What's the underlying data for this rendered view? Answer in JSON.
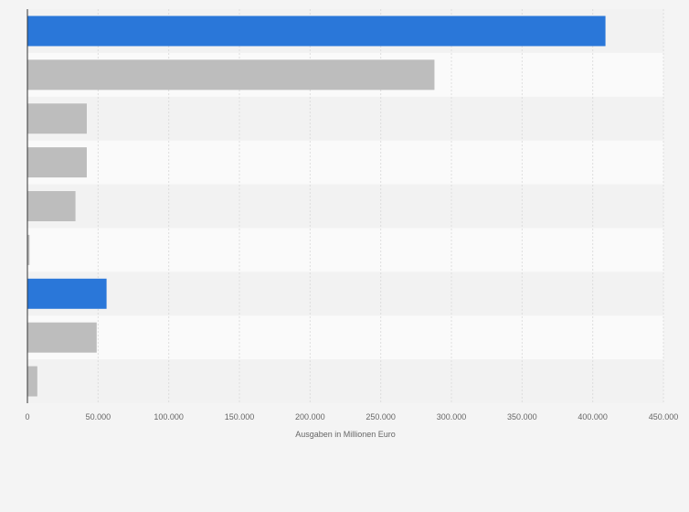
{
  "chart_data": {
    "type": "bar",
    "orientation": "horizontal",
    "xlabel": "Ausgaben in Millionen Euro",
    "xlim": [
      0,
      450000
    ],
    "x_ticks": [
      0,
      50000,
      100000,
      150000,
      200000,
      250000,
      300000,
      350000,
      400000,
      450000
    ],
    "x_tick_labels": [
      "0",
      "50.000",
      "100.000",
      "150.000",
      "200.000",
      "250.000",
      "300.000",
      "350.000",
      "400.000",
      "450.000"
    ],
    "grid": true,
    "legend": "none",
    "category_labels_visible": false,
    "series": [
      {
        "values": [
          409000,
          288000,
          42000,
          42000,
          34000,
          1500,
          56000,
          49000,
          7000
        ],
        "bar_colors": [
          "#2a77d9",
          "#bdbdbd",
          "#bdbdbd",
          "#bdbdbd",
          "#bdbdbd",
          "#bdbdbd",
          "#2a77d9",
          "#bdbdbd",
          "#bdbdbd"
        ]
      }
    ],
    "colors": {
      "highlight": "#2a77d9",
      "default": "#bdbdbd",
      "band_light": "#fafafa",
      "band_dark": "#f2f2f2",
      "grid": "#dddddd",
      "axis": "#333333"
    }
  }
}
